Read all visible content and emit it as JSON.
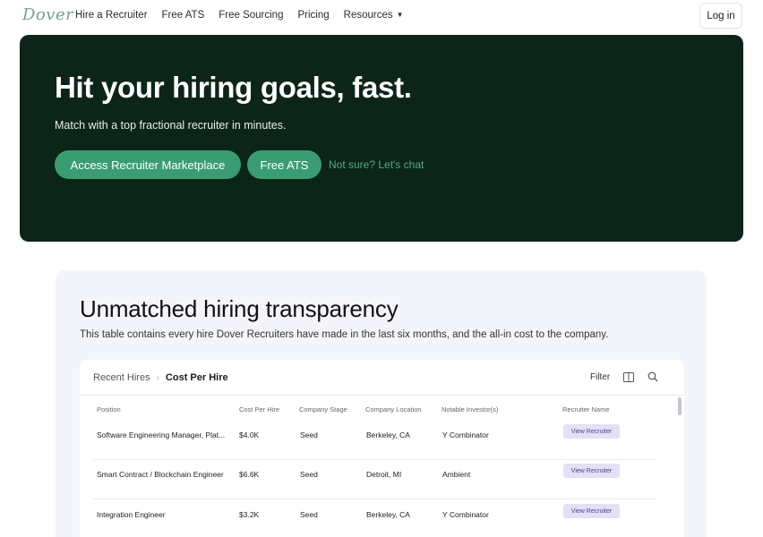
{
  "nav": {
    "logo": "Dover",
    "links": [
      "Hire a Recruiter",
      "Free ATS",
      "Free Sourcing",
      "Pricing",
      "Resources"
    ],
    "login": "Log in"
  },
  "hero": {
    "title": "Hit your hiring goals, fast.",
    "subtitle": "Match with a top fractional recruiter in minutes.",
    "btn_marketplace": "Access Recruiter Marketplace",
    "btn_ats": "Free ATS",
    "chat": "Not sure? Let's chat"
  },
  "section": {
    "title": "Unmatched hiring transparency",
    "subtitle": "This table contains every hire Dover Recruiters have made in the last six months, and the all-in cost to the company."
  },
  "table": {
    "breadcrumb_parent": "Recent Hires",
    "breadcrumb_current": "Cost Per Hire",
    "filter": "Filter",
    "columns": [
      "Position",
      "Cost Per Hire",
      "Company Stage",
      "Company Location",
      "Notable Investor(s)",
      "Recruiter Name"
    ],
    "rows": [
      {
        "position": "Software Engineering Manager, Plat...",
        "cost": "$4.0K",
        "stage": "Seed",
        "location": "Berkeley, CA",
        "investor": "Y Combinator",
        "action": "View Recruiter"
      },
      {
        "position": "Smart Contract / Blockchain Engineer",
        "cost": "$6.6K",
        "stage": "Seed",
        "location": "Detroit, MI",
        "investor": "Ambient",
        "action": "View Recruiter"
      },
      {
        "position": "Integration Engineer",
        "cost": "$3.2K",
        "stage": "Seed",
        "location": "Berkeley, CA",
        "investor": "Y Combinator",
        "action": "View Recruiter"
      }
    ]
  },
  "colors": {
    "hero_bg": "#0c2519",
    "accent_green": "#3a9d72",
    "section_bg": "#f4f5fb",
    "view_btn_bg": "#e3e0f7"
  }
}
